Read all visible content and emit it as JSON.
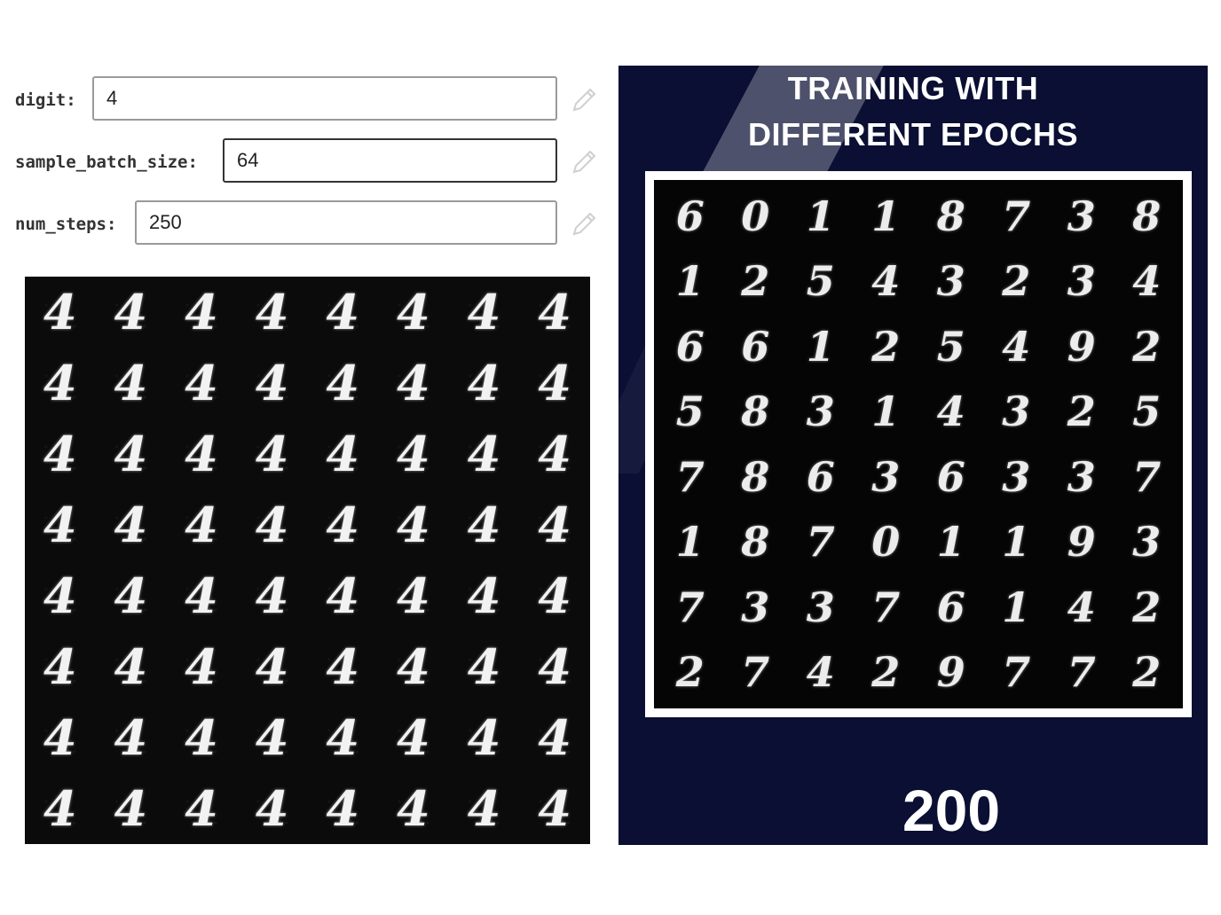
{
  "form": {
    "fields": [
      {
        "label": "digit:",
        "value": "4"
      },
      {
        "label": "sample_batch_size:",
        "value": "64"
      },
      {
        "label": "num_steps:",
        "value": "250"
      }
    ],
    "edit_icon": "pencil-icon"
  },
  "samples": {
    "rows": [
      [
        "4",
        "4",
        "4",
        "4",
        "4",
        "4",
        "4",
        "4"
      ],
      [
        "4",
        "4",
        "4",
        "4",
        "4",
        "4",
        "4",
        "4"
      ],
      [
        "4",
        "4",
        "4",
        "4",
        "4",
        "4",
        "4",
        "4"
      ],
      [
        "4",
        "4",
        "4",
        "4",
        "4",
        "4",
        "4",
        "4"
      ],
      [
        "4",
        "4",
        "4",
        "4",
        "4",
        "4",
        "4",
        "4"
      ],
      [
        "4",
        "4",
        "4",
        "4",
        "4",
        "4",
        "4",
        "4"
      ],
      [
        "4",
        "4",
        "4",
        "4",
        "4",
        "4",
        "4",
        "4"
      ],
      [
        "4",
        "4",
        "4",
        "4",
        "4",
        "4",
        "4",
        "4"
      ]
    ]
  },
  "poster": {
    "title_line1": "TRAINING WITH",
    "title_line2": "DIFFERENT EPOCHS",
    "epoch": "200",
    "background_color": "#0a0f33",
    "rows": [
      [
        "6",
        "0",
        "1",
        "1",
        "8",
        "7",
        "3",
        "8"
      ],
      [
        "1",
        "2",
        "5",
        "4",
        "3",
        "2",
        "3",
        "4"
      ],
      [
        "6",
        "6",
        "1",
        "2",
        "5",
        "4",
        "9",
        "2"
      ],
      [
        "5",
        "8",
        "3",
        "1",
        "4",
        "3",
        "2",
        "5"
      ],
      [
        "7",
        "8",
        "6",
        "3",
        "6",
        "3",
        "3",
        "7"
      ],
      [
        "1",
        "8",
        "7",
        "0",
        "1",
        "1",
        "9",
        "3"
      ],
      [
        "7",
        "3",
        "3",
        "7",
        "6",
        "1",
        "4",
        "2"
      ],
      [
        "2",
        "7",
        "4",
        "2",
        "9",
        "7",
        "7",
        "2"
      ]
    ]
  }
}
